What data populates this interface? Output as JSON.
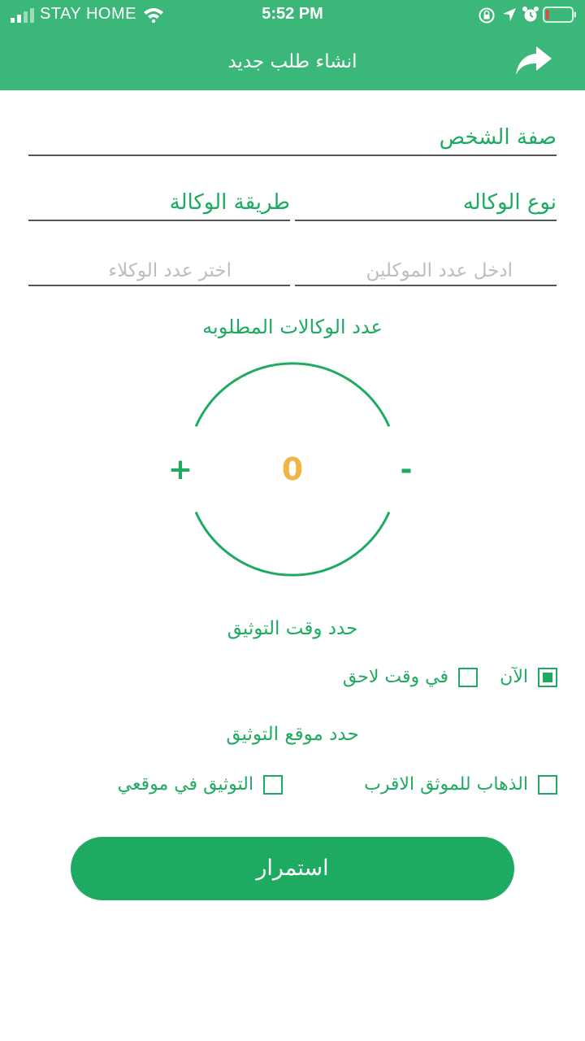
{
  "status_bar": {
    "carrier": "STAY HOME",
    "time": "5:52 PM",
    "icons": [
      "signal-icon",
      "wifi-icon",
      "orientation-lock-icon",
      "location-icon",
      "alarm-icon",
      "battery-icon"
    ]
  },
  "header": {
    "title": "انشاء طلب جديد",
    "forward_icon": "share-forward-icon",
    "background": "#3cb77a"
  },
  "form": {
    "person_capacity_label": "صفة الشخص",
    "agency_type_label": "نوع الوكاله",
    "agency_method_label": "طريقة الوكالة",
    "principals_count_placeholder": "ادخل عدد الموكلين",
    "agents_count_placeholder": "اختر عدد الوكلاء"
  },
  "counter": {
    "title": "عدد الوكالات المطلوبه",
    "value": "0",
    "plus_label": "+",
    "minus_label": "-"
  },
  "time_section": {
    "title": "حدد وقت التوثيق",
    "options": [
      {
        "label": "الآن",
        "checked": true
      },
      {
        "label": "في وقت لاحق",
        "checked": false
      }
    ]
  },
  "location_section": {
    "title": "حدد موقع التوثيق",
    "options": [
      {
        "label": "الذهاب للموثق الاقرب",
        "checked": false
      },
      {
        "label": "التوثيق في موقعي",
        "checked": false
      }
    ]
  },
  "continue_button": "استمرار",
  "colors": {
    "accent": "#1faa61",
    "counter_value": "#efb647",
    "placeholder": "#bdbdbd"
  }
}
